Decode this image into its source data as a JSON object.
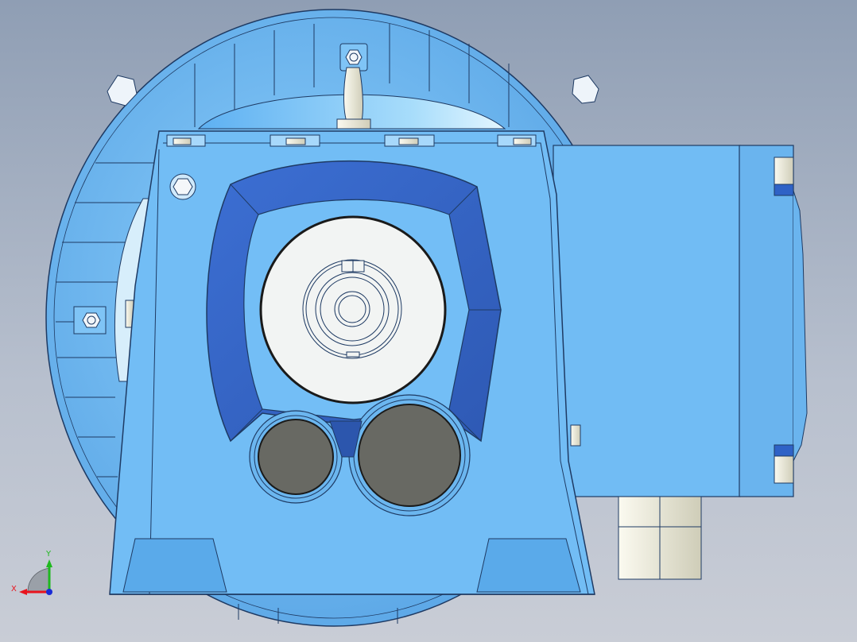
{
  "triad": {
    "x_label": "X",
    "y_label": "Y",
    "x_color": "#e8141e",
    "y_color": "#1fb81f",
    "z_color": "#1a2bd6"
  },
  "colors": {
    "body": "#6fb8f0",
    "body_light": "#8ccdfb",
    "flange_band": "#3667c8",
    "outline": "#1e3a63",
    "cover_plate": "#f2f4f3",
    "plug": "#6b6d66",
    "bolt": "#f3f1e2"
  },
  "icons": {
    "triad": "coordinate-triad-icon",
    "bolt": "hex-bolt-icon",
    "eyebolt": "lifting-eye-icon"
  }
}
